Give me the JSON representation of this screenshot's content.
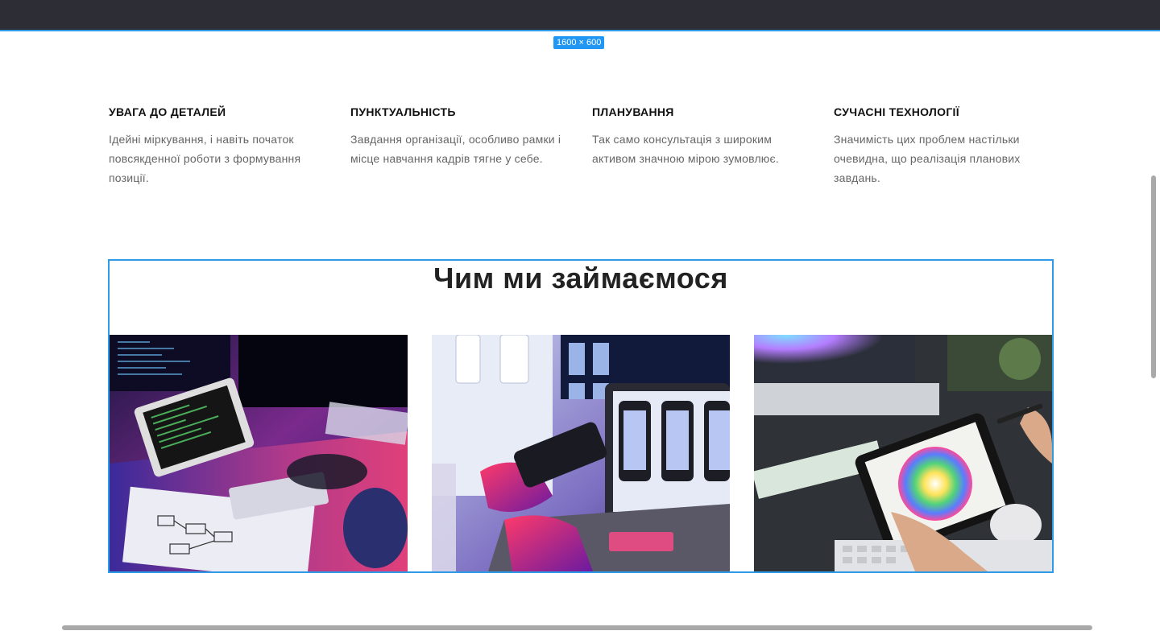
{
  "badge": {
    "label": "1600 × 600"
  },
  "features": [
    {
      "title": "УВАГА ДО ДЕТАЛЕЙ",
      "text": "Ідейні міркування, і навіть початок повсякденної роботи з формування позиції."
    },
    {
      "title": "ПУНКТУАЛЬНІСТЬ",
      "text": "Завдання організації, особливо рамки і місце навчання кадрів тягне у себе."
    },
    {
      "title": "ПЛАНУВАННЯ",
      "text": "Так само консультація з широким активом значною мірою зумовлює."
    },
    {
      "title": "СУЧАСНІ ТЕХНОЛОГІЇ",
      "text": "Значимість цих проблем настільки очевидна, що реалізація планових завдань."
    }
  ],
  "services": {
    "title": "Чим ми займаємося",
    "images": [
      {
        "name": "coding-laptop-photo"
      },
      {
        "name": "mobile-ui-design-photo"
      },
      {
        "name": "color-palette-tablet-photo"
      }
    ]
  },
  "colors": {
    "accent": "#2f9ae6",
    "topbar": "#2c2d35",
    "badge": "#2196f3",
    "heading": "#222222",
    "text": "#666666"
  }
}
